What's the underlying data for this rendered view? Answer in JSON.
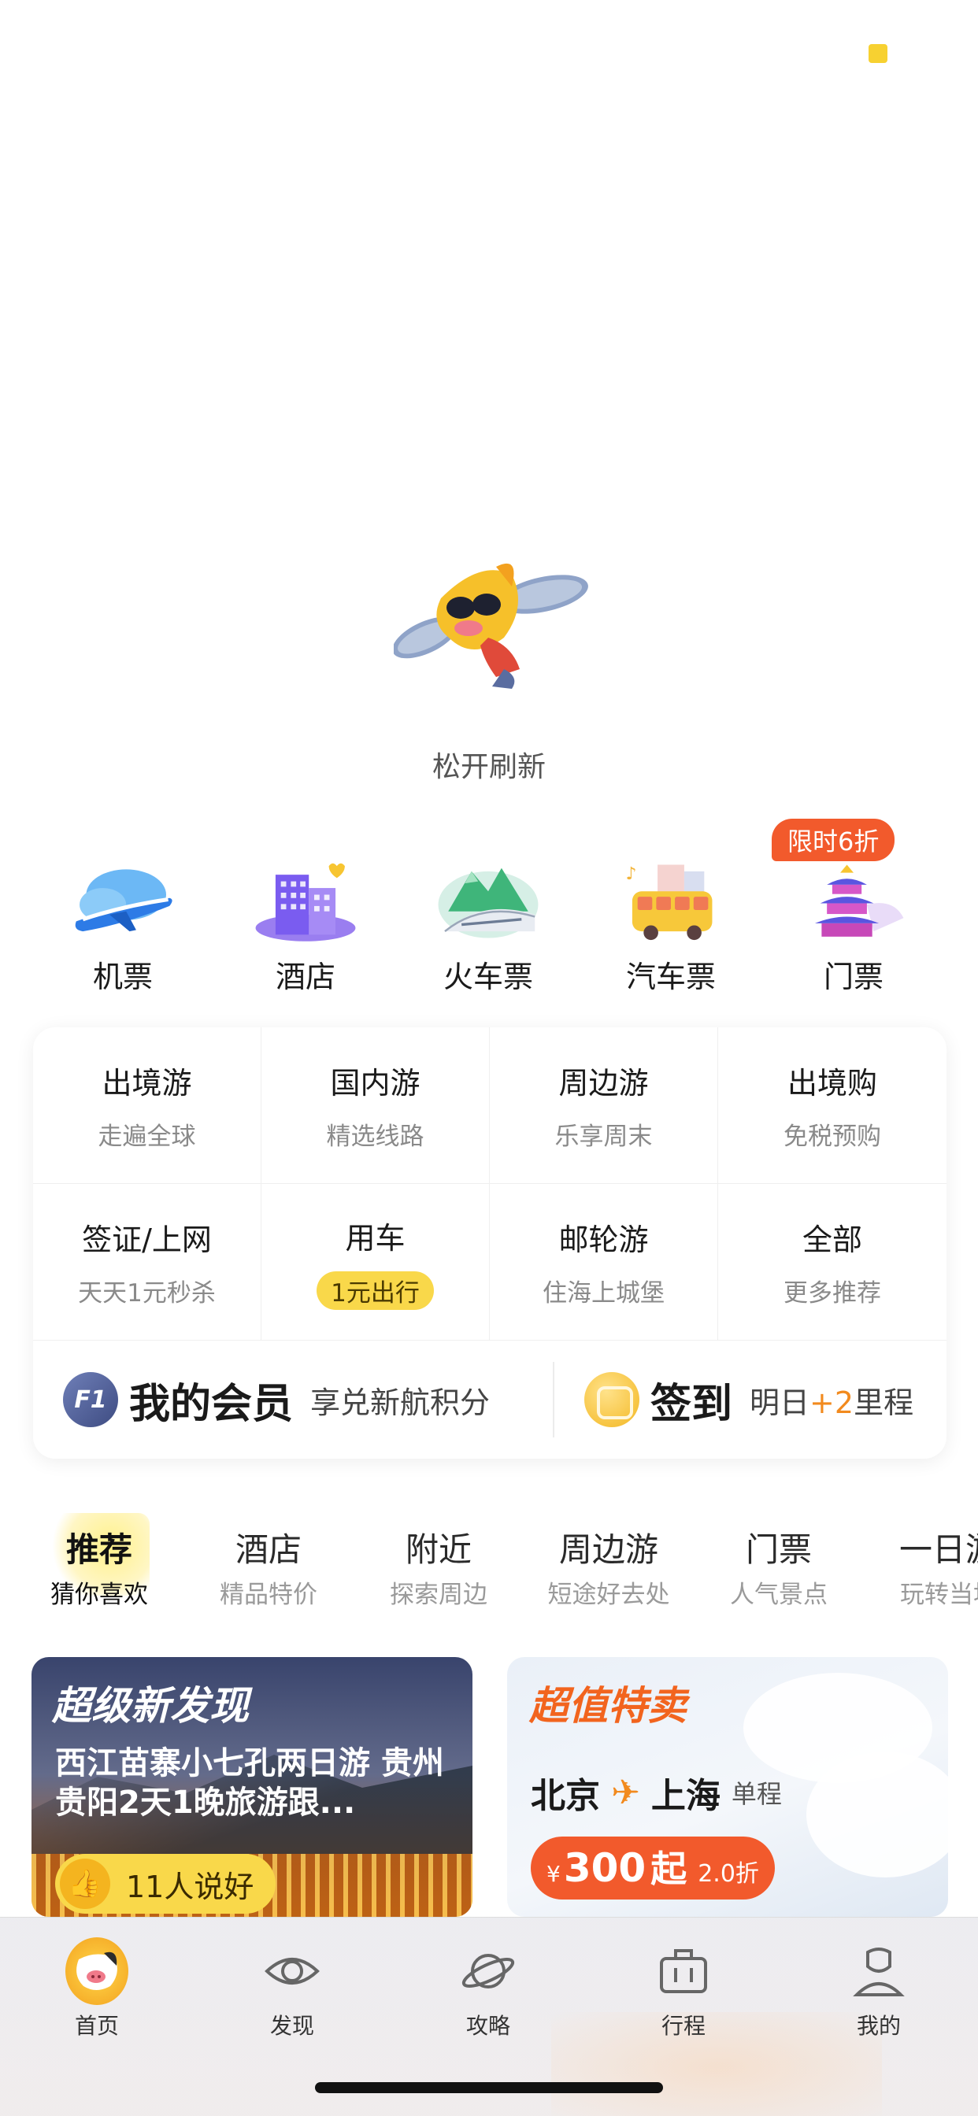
{
  "refresh_hint": "松开刷新",
  "main_categories": [
    {
      "label": "机票",
      "icon": "airplane-icon"
    },
    {
      "label": "酒店",
      "icon": "hotel-icon"
    },
    {
      "label": "火车票",
      "icon": "train-icon"
    },
    {
      "label": "汽车票",
      "icon": "bus-icon"
    },
    {
      "label": "门票",
      "icon": "temple-icon"
    }
  ],
  "promo_badge": "限时6折",
  "sub_services": [
    {
      "title": "出境游",
      "subtitle": "走遍全球"
    },
    {
      "title": "国内游",
      "subtitle": "精选线路"
    },
    {
      "title": "周边游",
      "subtitle": "乐享周末"
    },
    {
      "title": "出境购",
      "subtitle": "免税预购"
    },
    {
      "title": "签证/上网",
      "subtitle": "天天1元秒杀"
    },
    {
      "title": "用车",
      "subtitle": "1元出行"
    },
    {
      "title": "邮轮游",
      "subtitle": "住海上城堡"
    },
    {
      "title": "全部",
      "subtitle": "更多推荐"
    }
  ],
  "member": {
    "badge": "F1",
    "title": "我的会员",
    "desc": "享兑新航积分",
    "checkin_title": "签到",
    "checkin_prefix": "明日",
    "checkin_bonus": "+2",
    "checkin_suffix": "里程"
  },
  "feed_tabs": [
    {
      "title": "推荐",
      "subtitle": "猜你喜欢"
    },
    {
      "title": "酒店",
      "subtitle": "精品特价"
    },
    {
      "title": "附近",
      "subtitle": "探索周边"
    },
    {
      "title": "周边游",
      "subtitle": "短途好去处"
    },
    {
      "title": "门票",
      "subtitle": "人气景点"
    },
    {
      "title": "一日游",
      "subtitle": "玩转当地"
    }
  ],
  "card_discovery": {
    "title": "超级新发现",
    "desc": "西江苗寨小七孔两日游 贵州贵阳2天1晚旅游跟...",
    "likes": "11人说好"
  },
  "card_deal": {
    "title": "超值特卖",
    "from": "北京",
    "to": "上海",
    "trip_type": "单程",
    "currency": "¥",
    "price": "300",
    "price_suffix": "起",
    "discount": "2.0折"
  },
  "bottom_nav": [
    {
      "label": "首页",
      "icon": "home-pig-icon"
    },
    {
      "label": "发现",
      "icon": "eye-icon"
    },
    {
      "label": "攻略",
      "icon": "planet-icon"
    },
    {
      "label": "行程",
      "icon": "suitcase-icon"
    },
    {
      "label": "我的",
      "icon": "profile-icon"
    }
  ],
  "colors": {
    "accent_orange": "#f25a2c",
    "accent_yellow": "#f9d84a",
    "bonus_orange": "#f28a1e"
  }
}
